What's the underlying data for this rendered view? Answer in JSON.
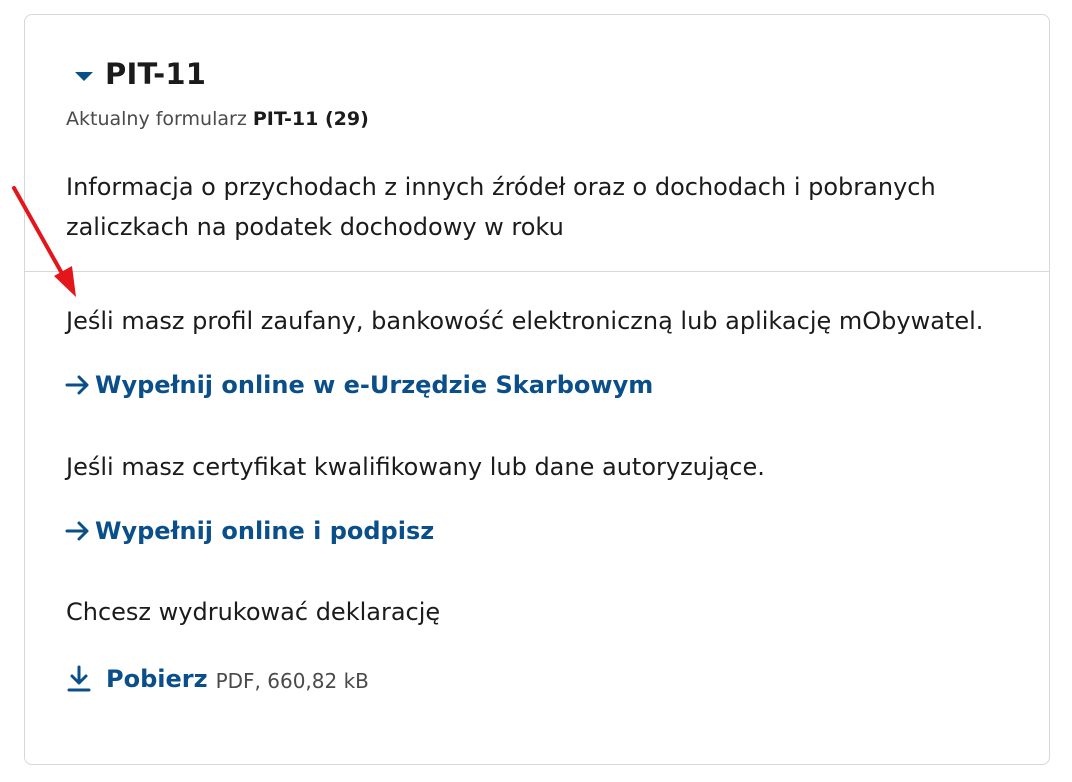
{
  "card": {
    "title": "PIT-11",
    "current_form_prefix": "Aktualny formularz",
    "current_form_name": "PIT-11 (29)",
    "description": "Informacja o przychodach z innych źródeł oraz o dochodach i pobranych zaliczkach na podatek dochodowy w roku",
    "section_profile_text": "Jeśli masz profil zaufany, bankowość elektroniczną lub aplikację mObywatel.",
    "link_eus": "Wypełnij online w e-Urzędzie Skarbowym",
    "section_cert_text": "Jeśli masz certyfikat kwalifikowany lub dane autoryzujące.",
    "link_sign": "Wypełnij online i podpisz",
    "section_print_text": "Chcesz wydrukować deklarację",
    "download_label": "Pobierz",
    "file_meta": "PDF, 660,82 kB"
  },
  "colors": {
    "link": "#0b4f8a",
    "annotation_arrow": "#e3161b",
    "border": "#d7d7d7"
  },
  "icons": {
    "collapse": "caret-down-icon",
    "link_arrow": "arrow-right-icon",
    "download": "download-icon"
  }
}
